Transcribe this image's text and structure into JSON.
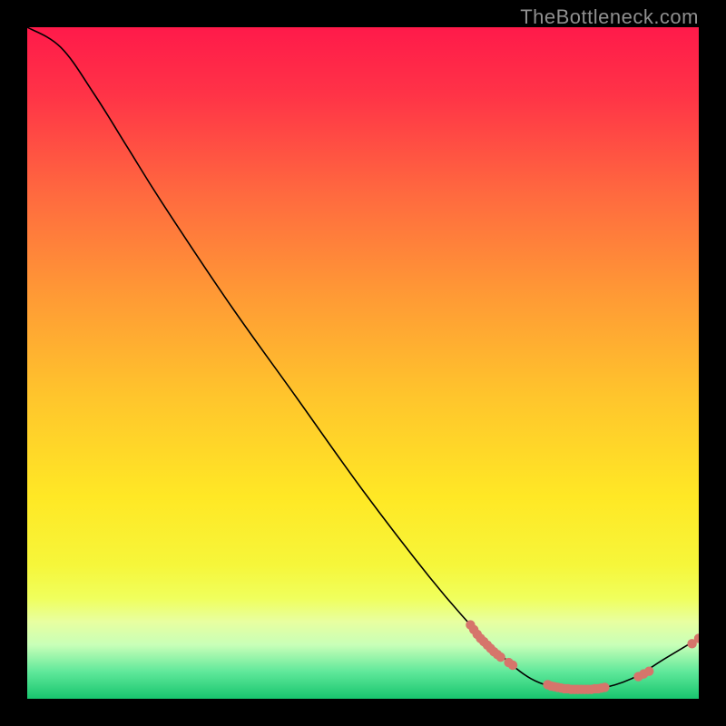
{
  "attribution": "TheBottleneck.com",
  "chart_data": {
    "type": "line",
    "title": "",
    "xlabel": "",
    "ylabel": "",
    "xlim": [
      0,
      100
    ],
    "ylim": [
      0,
      100
    ],
    "curve": {
      "name": "bottleneck-curve",
      "points": [
        {
          "x": 0,
          "y": 100
        },
        {
          "x": 5,
          "y": 97
        },
        {
          "x": 10,
          "y": 90
        },
        {
          "x": 15,
          "y": 82
        },
        {
          "x": 20,
          "y": 74
        },
        {
          "x": 30,
          "y": 59
        },
        {
          "x": 40,
          "y": 45
        },
        {
          "x": 50,
          "y": 31
        },
        {
          "x": 60,
          "y": 18
        },
        {
          "x": 66,
          "y": 11
        },
        {
          "x": 70,
          "y": 7
        },
        {
          "x": 75,
          "y": 3
        },
        {
          "x": 80,
          "y": 1.5
        },
        {
          "x": 85,
          "y": 1.5
        },
        {
          "x": 90,
          "y": 3
        },
        {
          "x": 95,
          "y": 6
        },
        {
          "x": 100,
          "y": 9
        }
      ]
    },
    "marker_clusters": [
      {
        "name": "left-dense-cluster",
        "color": "#d6756b",
        "points": [
          {
            "x": 66,
            "y": 11
          },
          {
            "x": 66.5,
            "y": 10.3
          },
          {
            "x": 67,
            "y": 9.6
          },
          {
            "x": 67.5,
            "y": 9.0
          },
          {
            "x": 68,
            "y": 8.5
          },
          {
            "x": 68.5,
            "y": 8.0
          },
          {
            "x": 69,
            "y": 7.5
          },
          {
            "x": 69.5,
            "y": 7.0
          },
          {
            "x": 70,
            "y": 6.6
          },
          {
            "x": 70.5,
            "y": 6.2
          },
          {
            "x": 71.7,
            "y": 5.4
          },
          {
            "x": 72.3,
            "y": 5.0
          }
        ]
      },
      {
        "name": "bottom-dense-cluster",
        "color": "#d6756b",
        "points": [
          {
            "x": 77.5,
            "y": 2.1
          },
          {
            "x": 78.0,
            "y": 1.9
          },
          {
            "x": 78.5,
            "y": 1.8
          },
          {
            "x": 79.0,
            "y": 1.7
          },
          {
            "x": 79.5,
            "y": 1.6
          },
          {
            "x": 80.0,
            "y": 1.5
          },
          {
            "x": 80.5,
            "y": 1.5
          },
          {
            "x": 81.0,
            "y": 1.4
          },
          {
            "x": 81.5,
            "y": 1.4
          },
          {
            "x": 82.0,
            "y": 1.4
          },
          {
            "x": 82.5,
            "y": 1.4
          },
          {
            "x": 83.0,
            "y": 1.4
          },
          {
            "x": 83.5,
            "y": 1.4
          },
          {
            "x": 84.0,
            "y": 1.4
          },
          {
            "x": 84.5,
            "y": 1.5
          },
          {
            "x": 85.0,
            "y": 1.5
          },
          {
            "x": 85.5,
            "y": 1.6
          },
          {
            "x": 86.0,
            "y": 1.7
          }
        ]
      },
      {
        "name": "right-sparse-cluster",
        "color": "#d6756b",
        "points": [
          {
            "x": 91.0,
            "y": 3.3
          },
          {
            "x": 91.8,
            "y": 3.7
          },
          {
            "x": 92.6,
            "y": 4.1
          }
        ]
      },
      {
        "name": "right-end-pair",
        "color": "#d6756b",
        "points": [
          {
            "x": 99.0,
            "y": 8.2
          },
          {
            "x": 100.0,
            "y": 9.0
          }
        ]
      }
    ],
    "background_gradient": {
      "stops": [
        {
          "offset": 0.0,
          "color": "#ff1a4a"
        },
        {
          "offset": 0.1,
          "color": "#ff3347"
        },
        {
          "offset": 0.25,
          "color": "#ff6a3f"
        },
        {
          "offset": 0.4,
          "color": "#ff9a35"
        },
        {
          "offset": 0.55,
          "color": "#ffc52c"
        },
        {
          "offset": 0.7,
          "color": "#ffe825"
        },
        {
          "offset": 0.8,
          "color": "#f6f63a"
        },
        {
          "offset": 0.85,
          "color": "#f0ff5c"
        },
        {
          "offset": 0.885,
          "color": "#e8ffa0"
        },
        {
          "offset": 0.92,
          "color": "#c8ffb8"
        },
        {
          "offset": 0.96,
          "color": "#5fe89a"
        },
        {
          "offset": 1.0,
          "color": "#18c56e"
        }
      ]
    }
  }
}
